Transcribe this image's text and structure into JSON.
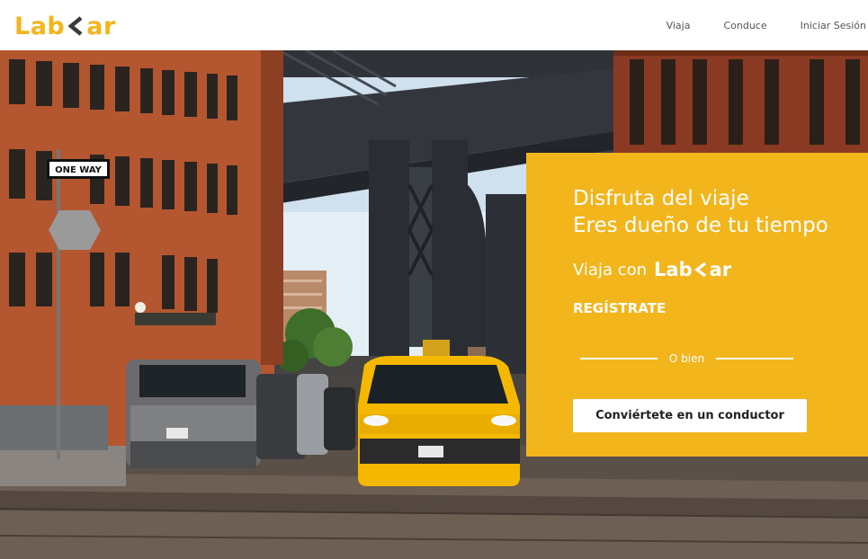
{
  "brand": {
    "logo_left": "Lab",
    "logo_right": "ar",
    "logo_chevron_icon": "chevron-left-icon",
    "accent_color": "#f2b51c"
  },
  "nav": {
    "items": [
      {
        "label": "Viaja"
      },
      {
        "label": "Conduce"
      },
      {
        "label": "Iniciar Sesión"
      }
    ]
  },
  "promo": {
    "headline_line1": "Disfruta del viaje",
    "headline_line2": "Eres dueño de tu tiempo",
    "ride_prefix": "Viaja con",
    "register_label": "REGÍSTRATE",
    "or_label": "O bien",
    "driver_button_label": "Conviértete en un conductor"
  },
  "hero": {
    "sign_one_way": "ONE WAY"
  }
}
